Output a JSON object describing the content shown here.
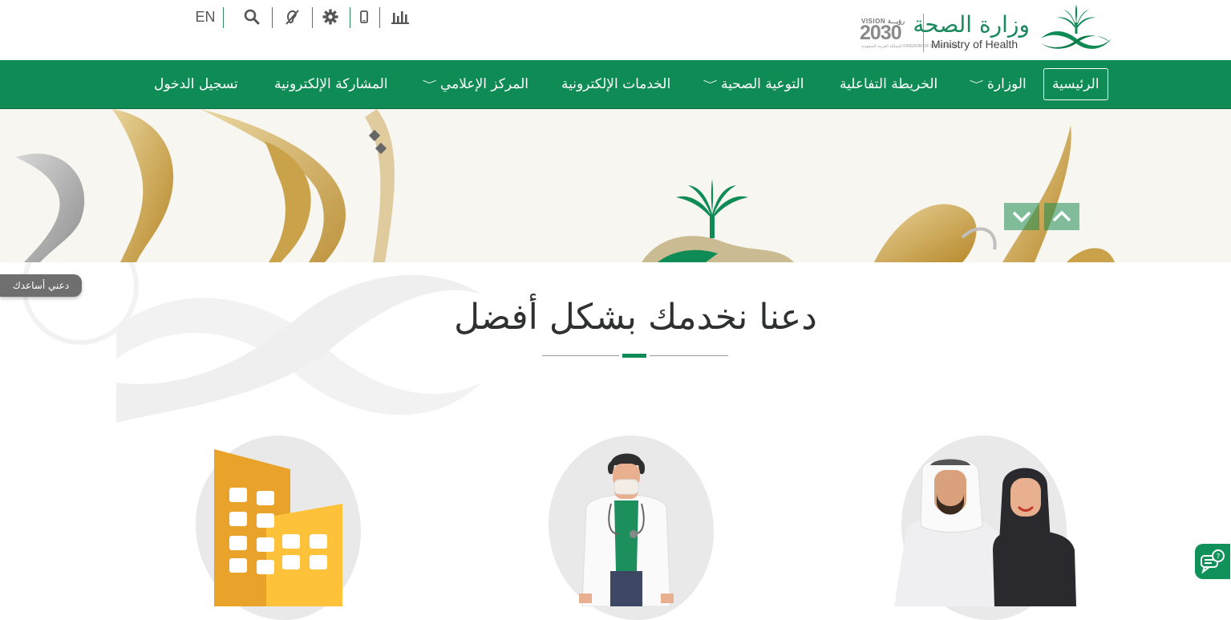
{
  "header": {
    "language_toggle": "EN",
    "icons": [
      "search-icon",
      "hearing-accessibility-icon",
      "gear-icon",
      "mobile-icon",
      "stats-chart-icon"
    ],
    "logo": {
      "name_ar": "وزارة الصحة",
      "name_en": "Ministry of Health",
      "vision_label": "VISION رؤيـــة",
      "vision_year": "2030",
      "vision_sub": "المملكة العربية السعودية KINGDOM OF SAUDI ARABIA"
    }
  },
  "nav": {
    "items": [
      {
        "label": "الرئيسية",
        "dropdown": false,
        "active": true
      },
      {
        "label": "الوزارة",
        "dropdown": true
      },
      {
        "label": "الخريطة التفاعلية",
        "dropdown": false
      },
      {
        "label": "التوعية الصحية",
        "dropdown": true
      },
      {
        "label": "الخدمات الإلكترونية",
        "dropdown": false
      },
      {
        "label": "المركز الإعلامي",
        "dropdown": true
      },
      {
        "label": "المشاركة الإلكترونية",
        "dropdown": false
      },
      {
        "label": "تسجيل الدخول",
        "dropdown": false
      }
    ],
    "chevron": "﹀"
  },
  "hero": {
    "controls": [
      "chevron-up-icon",
      "chevron-down-icon"
    ]
  },
  "section": {
    "title": "دعنا نخدمك بشكل أفضل"
  },
  "help_tab": {
    "label": "دعني أساعدك"
  },
  "cards": [
    {
      "illustration": "citizens-illustration"
    },
    {
      "illustration": "doctor-illustration"
    },
    {
      "illustration": "facilities-illustration"
    }
  ],
  "colors": {
    "primary_green": "#0f8b55",
    "gold": "#c9a24a",
    "text_dark": "#2f3030"
  }
}
